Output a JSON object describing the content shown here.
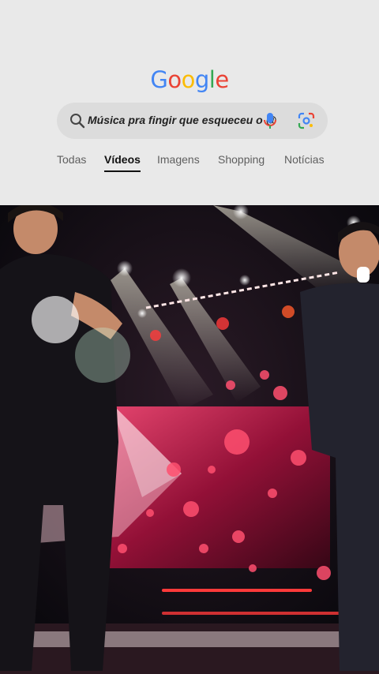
{
  "logo": {
    "letters": [
      "G",
      "o",
      "o",
      "g",
      "l",
      "e"
    ],
    "colors": [
      "#4285F4",
      "#EA4335",
      "#FBBC05",
      "#4285F4",
      "#34A853",
      "#EA4335"
    ]
  },
  "search": {
    "query": "Música pra fingir que esqueceu o @",
    "icons": [
      "search-icon",
      "mic-icon",
      "lens-icon"
    ]
  },
  "tabs": [
    {
      "label": "Todas",
      "active": false
    },
    {
      "label": "Vídeos",
      "active": true
    },
    {
      "label": "Imagens",
      "active": false
    },
    {
      "label": "Shopping",
      "active": false
    },
    {
      "label": "Notícias",
      "active": false
    }
  ],
  "video": {
    "description_icon": "video-frame"
  }
}
